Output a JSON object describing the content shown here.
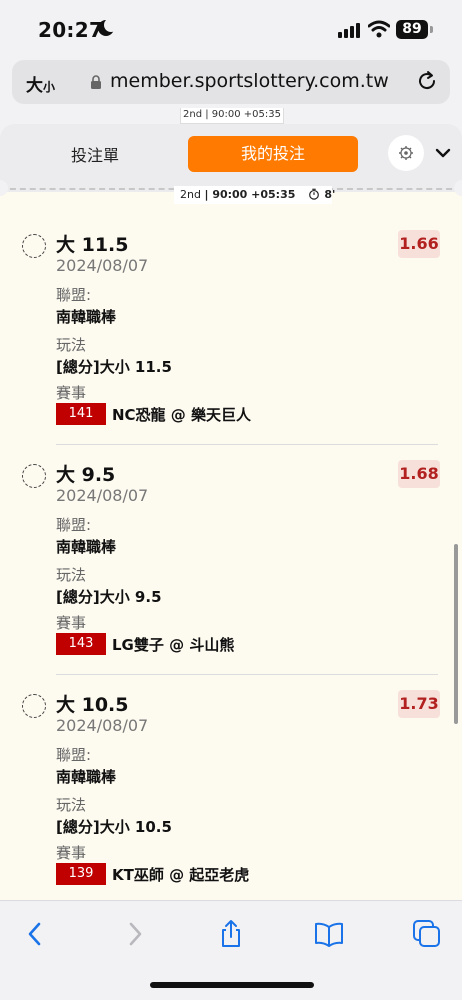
{
  "status": {
    "time": "20:27",
    "battery": "89"
  },
  "browser": {
    "text_size": "大",
    "text_size_small": "小",
    "url": "member.sportslottery.com.tw"
  },
  "peek_tag": "2nd | 90:00 +05:35",
  "tabs": {
    "betslip": "投注單",
    "my_bets": "我的投注"
  },
  "match_info": {
    "period": "2nd",
    "clock": "90:00 +05:35",
    "elapsed": "8'"
  },
  "labels": {
    "league": "聯盟:",
    "market": "玩法",
    "event": "賽事"
  },
  "bets": [
    {
      "title": "大 11.5",
      "date": "2024/08/07",
      "odds": "1.66",
      "league": "南韓職棒",
      "market": "[總分]大小 11.5",
      "event_no": "141",
      "event_name": "NC恐龍 @ 樂天巨人"
    },
    {
      "title": "大 9.5",
      "date": "2024/08/07",
      "odds": "1.68",
      "league": "南韓職棒",
      "market": "[總分]大小 9.5",
      "event_no": "143",
      "event_name": "LG雙子 @ 斗山熊"
    },
    {
      "title": "大 10.5",
      "date": "2024/08/07",
      "odds": "1.73",
      "league": "南韓職棒",
      "market": "[總分]大小 10.5",
      "event_no": "139",
      "event_name": "KT巫師 @ 起亞老虎"
    }
  ],
  "colors": {
    "accent": "#ff7a00",
    "odds_text": "#b22020",
    "event_badge": "#c00000",
    "ios_blue": "#1a73e8"
  },
  "toolbar_icons": [
    "back-icon",
    "forward-icon",
    "share-icon",
    "bookmarks-icon",
    "tabs-icon"
  ]
}
